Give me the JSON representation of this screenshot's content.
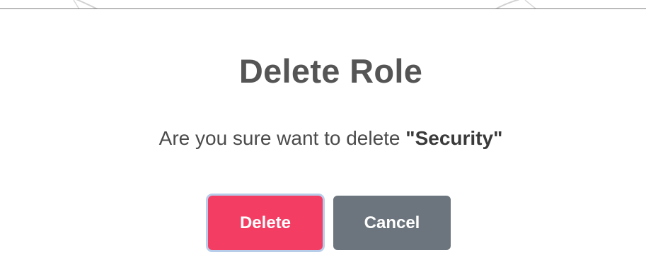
{
  "dialog": {
    "title": "Delete Role",
    "message_prefix": "Are you sure want to delete ",
    "item_name": "\"Security\"",
    "buttons": {
      "delete_label": "Delete",
      "cancel_label": "Cancel"
    }
  },
  "colors": {
    "delete_button": "#f43d63",
    "cancel_button": "#6c757d",
    "title_text": "#555555",
    "focus_ring": "#b7cdea"
  }
}
